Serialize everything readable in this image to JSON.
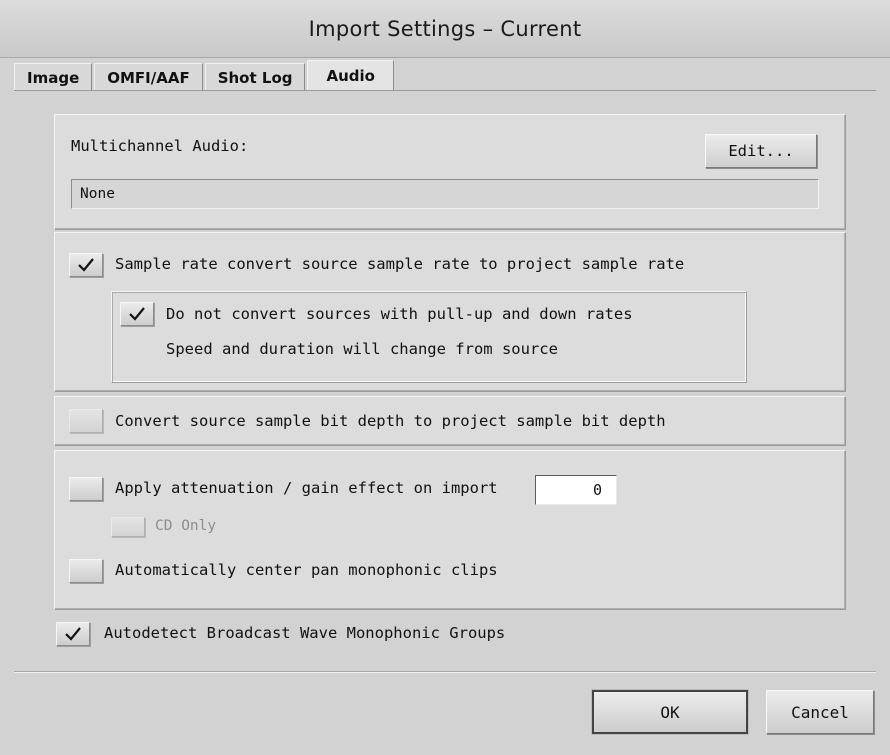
{
  "window": {
    "title": "Import Settings – Current"
  },
  "tabs": [
    {
      "label": "Image"
    },
    {
      "label": "OMFI/AAF"
    },
    {
      "label": "Shot Log"
    },
    {
      "label": "Audio"
    }
  ],
  "multichannel": {
    "label": "Multichannel Audio:",
    "edit_label": "Edit...",
    "value": "None"
  },
  "sample_rate": {
    "convert_label": "Sample rate convert source sample rate to project sample rate",
    "convert_checked": true,
    "pullup_label": "Do not convert sources with pull-up and down rates",
    "pullup_checked": true,
    "note": "Speed and duration will change from source"
  },
  "bit_depth": {
    "label": "Convert source sample bit depth to project sample bit depth",
    "checked": false
  },
  "gain": {
    "attenuation_label": "Apply attenuation / gain effect on import",
    "attenuation_checked": false,
    "attenuation_value": "0",
    "cd_only_label": "CD Only",
    "cd_only_checked": false,
    "center_pan_label": "Automatically center pan monophonic clips",
    "center_pan_checked": false
  },
  "autodetect": {
    "label": "Autodetect Broadcast Wave Monophonic Groups",
    "checked": true
  },
  "buttons": {
    "ok_label": "OK",
    "cancel_label": "Cancel"
  },
  "icons": {
    "check": "checkmark-icon"
  }
}
